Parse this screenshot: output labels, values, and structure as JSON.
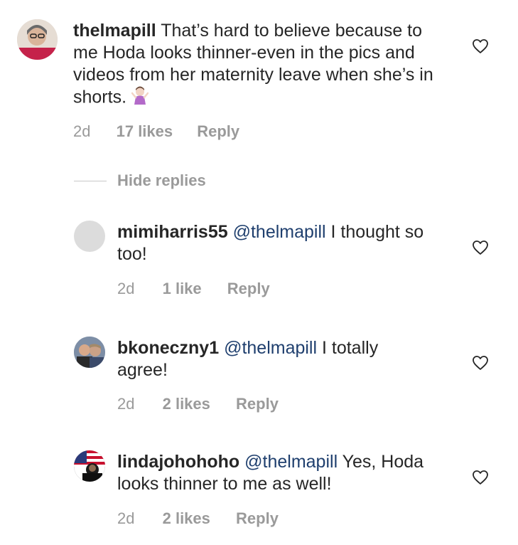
{
  "comments": [
    {
      "username": "thelmapill",
      "text": "That’s hard to believe because to me Hoda looks thinner-even in the pics and videos from her maternity leave when she’s in shorts.",
      "emoji": "person-shrugging-emoji",
      "time": "2d",
      "likes": "17 likes",
      "reply": "Reply"
    }
  ],
  "hide_replies": "Hide replies",
  "replies": [
    {
      "username": "mimiharris55",
      "mention": "@thelmapill",
      "text": "I thought so too!",
      "time": "2d",
      "likes": "1 like",
      "reply": "Reply"
    },
    {
      "username": "bkoneczny1",
      "mention": "@thelmapill",
      "text": "I totally agree!",
      "time": "2d",
      "likes": "2 likes",
      "reply": "Reply"
    },
    {
      "username": "lindajohohoho",
      "mention": "@thelmapill",
      "text": "Yes, Hoda looks thinner to me as well!",
      "time": "2d",
      "likes": "2 likes",
      "reply": "Reply"
    }
  ],
  "colors": {
    "text": "#262626",
    "muted": "#9a9a9a",
    "mention": "#1f3f6e"
  },
  "icons": [
    "heart-icon",
    "avatar"
  ]
}
